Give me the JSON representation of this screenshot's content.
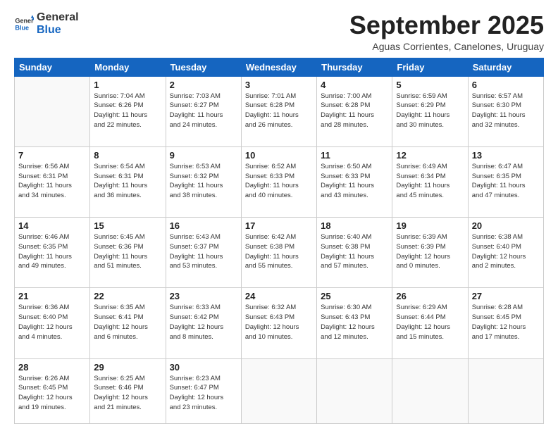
{
  "logo": {
    "line1": "General",
    "line2": "Blue"
  },
  "title": "September 2025",
  "subtitle": "Aguas Corrientes, Canelones, Uruguay",
  "days_header": [
    "Sunday",
    "Monday",
    "Tuesday",
    "Wednesday",
    "Thursday",
    "Friday",
    "Saturday"
  ],
  "weeks": [
    [
      {
        "day": "",
        "info": ""
      },
      {
        "day": "1",
        "info": "Sunrise: 7:04 AM\nSunset: 6:26 PM\nDaylight: 11 hours\nand 22 minutes."
      },
      {
        "day": "2",
        "info": "Sunrise: 7:03 AM\nSunset: 6:27 PM\nDaylight: 11 hours\nand 24 minutes."
      },
      {
        "day": "3",
        "info": "Sunrise: 7:01 AM\nSunset: 6:28 PM\nDaylight: 11 hours\nand 26 minutes."
      },
      {
        "day": "4",
        "info": "Sunrise: 7:00 AM\nSunset: 6:28 PM\nDaylight: 11 hours\nand 28 minutes."
      },
      {
        "day": "5",
        "info": "Sunrise: 6:59 AM\nSunset: 6:29 PM\nDaylight: 11 hours\nand 30 minutes."
      },
      {
        "day": "6",
        "info": "Sunrise: 6:57 AM\nSunset: 6:30 PM\nDaylight: 11 hours\nand 32 minutes."
      }
    ],
    [
      {
        "day": "7",
        "info": "Sunrise: 6:56 AM\nSunset: 6:31 PM\nDaylight: 11 hours\nand 34 minutes."
      },
      {
        "day": "8",
        "info": "Sunrise: 6:54 AM\nSunset: 6:31 PM\nDaylight: 11 hours\nand 36 minutes."
      },
      {
        "day": "9",
        "info": "Sunrise: 6:53 AM\nSunset: 6:32 PM\nDaylight: 11 hours\nand 38 minutes."
      },
      {
        "day": "10",
        "info": "Sunrise: 6:52 AM\nSunset: 6:33 PM\nDaylight: 11 hours\nand 40 minutes."
      },
      {
        "day": "11",
        "info": "Sunrise: 6:50 AM\nSunset: 6:33 PM\nDaylight: 11 hours\nand 43 minutes."
      },
      {
        "day": "12",
        "info": "Sunrise: 6:49 AM\nSunset: 6:34 PM\nDaylight: 11 hours\nand 45 minutes."
      },
      {
        "day": "13",
        "info": "Sunrise: 6:47 AM\nSunset: 6:35 PM\nDaylight: 11 hours\nand 47 minutes."
      }
    ],
    [
      {
        "day": "14",
        "info": "Sunrise: 6:46 AM\nSunset: 6:35 PM\nDaylight: 11 hours\nand 49 minutes."
      },
      {
        "day": "15",
        "info": "Sunrise: 6:45 AM\nSunset: 6:36 PM\nDaylight: 11 hours\nand 51 minutes."
      },
      {
        "day": "16",
        "info": "Sunrise: 6:43 AM\nSunset: 6:37 PM\nDaylight: 11 hours\nand 53 minutes."
      },
      {
        "day": "17",
        "info": "Sunrise: 6:42 AM\nSunset: 6:38 PM\nDaylight: 11 hours\nand 55 minutes."
      },
      {
        "day": "18",
        "info": "Sunrise: 6:40 AM\nSunset: 6:38 PM\nDaylight: 11 hours\nand 57 minutes."
      },
      {
        "day": "19",
        "info": "Sunrise: 6:39 AM\nSunset: 6:39 PM\nDaylight: 12 hours\nand 0 minutes."
      },
      {
        "day": "20",
        "info": "Sunrise: 6:38 AM\nSunset: 6:40 PM\nDaylight: 12 hours\nand 2 minutes."
      }
    ],
    [
      {
        "day": "21",
        "info": "Sunrise: 6:36 AM\nSunset: 6:40 PM\nDaylight: 12 hours\nand 4 minutes."
      },
      {
        "day": "22",
        "info": "Sunrise: 6:35 AM\nSunset: 6:41 PM\nDaylight: 12 hours\nand 6 minutes."
      },
      {
        "day": "23",
        "info": "Sunrise: 6:33 AM\nSunset: 6:42 PM\nDaylight: 12 hours\nand 8 minutes."
      },
      {
        "day": "24",
        "info": "Sunrise: 6:32 AM\nSunset: 6:43 PM\nDaylight: 12 hours\nand 10 minutes."
      },
      {
        "day": "25",
        "info": "Sunrise: 6:30 AM\nSunset: 6:43 PM\nDaylight: 12 hours\nand 12 minutes."
      },
      {
        "day": "26",
        "info": "Sunrise: 6:29 AM\nSunset: 6:44 PM\nDaylight: 12 hours\nand 15 minutes."
      },
      {
        "day": "27",
        "info": "Sunrise: 6:28 AM\nSunset: 6:45 PM\nDaylight: 12 hours\nand 17 minutes."
      }
    ],
    [
      {
        "day": "28",
        "info": "Sunrise: 6:26 AM\nSunset: 6:45 PM\nDaylight: 12 hours\nand 19 minutes."
      },
      {
        "day": "29",
        "info": "Sunrise: 6:25 AM\nSunset: 6:46 PM\nDaylight: 12 hours\nand 21 minutes."
      },
      {
        "day": "30",
        "info": "Sunrise: 6:23 AM\nSunset: 6:47 PM\nDaylight: 12 hours\nand 23 minutes."
      },
      {
        "day": "",
        "info": ""
      },
      {
        "day": "",
        "info": ""
      },
      {
        "day": "",
        "info": ""
      },
      {
        "day": "",
        "info": ""
      }
    ]
  ]
}
